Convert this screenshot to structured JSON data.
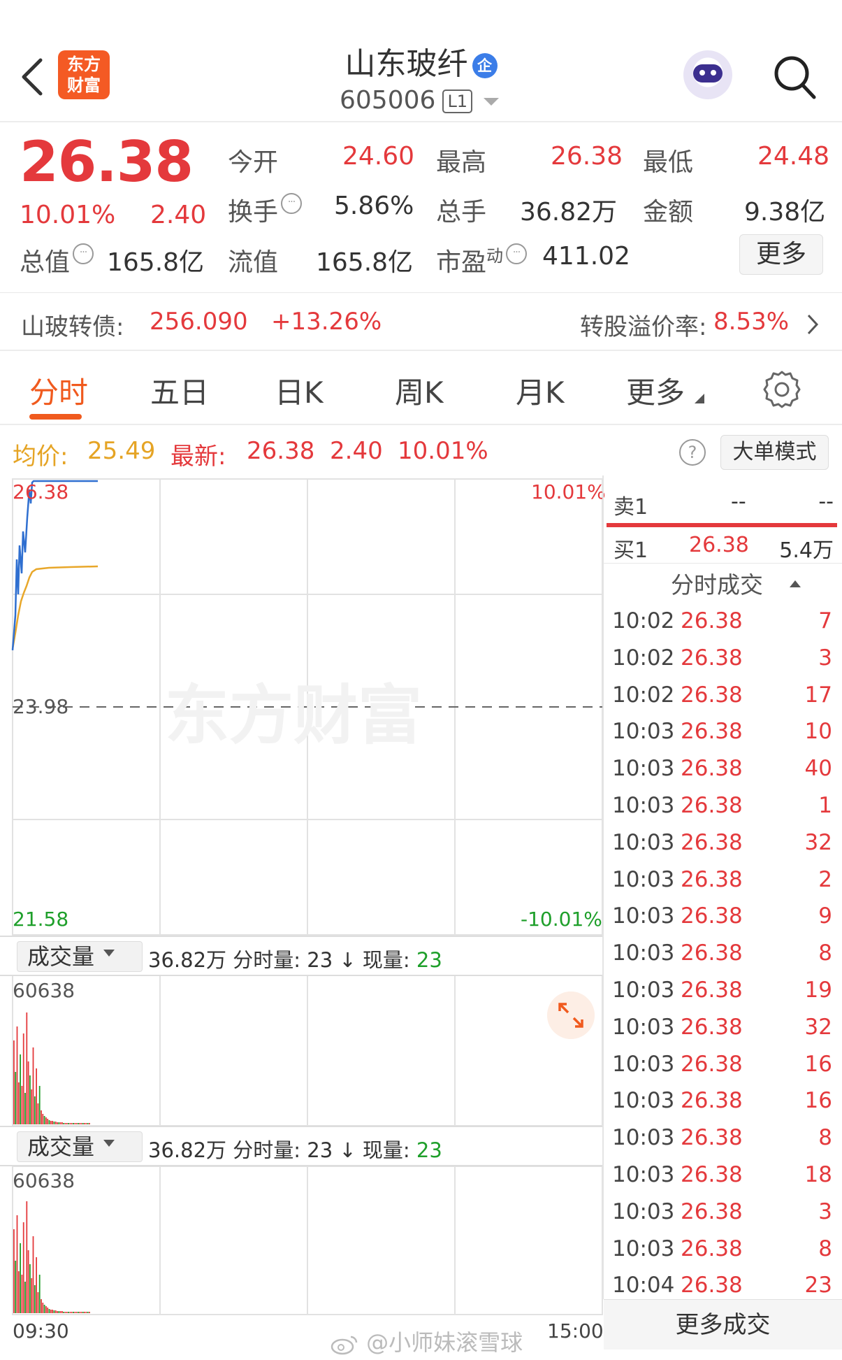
{
  "header": {
    "logo_line1": "东方",
    "logo_line2": "财富",
    "stock_name": "山东玻纤",
    "ent_badge": "企",
    "stock_code": "605006",
    "level_badge": "L1"
  },
  "quote": {
    "price": "26.38",
    "change_pct": "10.01%",
    "change": "2.40",
    "open_label": "今开",
    "open": "24.60",
    "high_label": "最高",
    "high": "26.38",
    "low_label": "最低",
    "low": "24.48",
    "turnover_label": "换手",
    "turnover": "5.86%",
    "volume_label": "总手",
    "volume": "36.82万",
    "amount_label": "金额",
    "amount": "9.38亿",
    "mktcap_label": "总值",
    "mktcap": "165.8亿",
    "float_label": "流值",
    "float_cap": "165.8亿",
    "pe_label": "市盈",
    "pe_sup": "动",
    "pe": "411.02",
    "more_label": "更多"
  },
  "bond": {
    "name": "山玻转债:",
    "price": "256.090",
    "change": "+13.26%",
    "premium_label": "转股溢价率:",
    "premium": "8.53%"
  },
  "tabs": [
    {
      "label": "分时",
      "active": true
    },
    {
      "label": "五日"
    },
    {
      "label": "日K"
    },
    {
      "label": "周K"
    },
    {
      "label": "月K"
    },
    {
      "label": "更多"
    }
  ],
  "avg_row": {
    "avg_label": "均价:",
    "avg": "25.49",
    "latest_label": "最新:",
    "latest": "26.38",
    "latest_change": "2.40",
    "latest_pct": "10.01%",
    "help": "?",
    "bigorder_label": "大单模式"
  },
  "chart": {
    "top_price": "26.38",
    "top_pct": "10.01%",
    "mid_price": "23.98",
    "bottom_price": "21.58",
    "bottom_pct": "-10.01%",
    "watermark": "东方财富",
    "x_start": "09:30",
    "x_end": "15:00",
    "colors": {
      "price_line": "#2f6fd0",
      "avg_line": "#e8a72a",
      "up": "#e4393c",
      "down": "#1e9f2a"
    }
  },
  "volume_panels": [
    {
      "select": "成交量",
      "total": "36.82万",
      "minute_label": "分时量:",
      "minute": "23",
      "arrow": "↓",
      "now_label": "现量:",
      "now": "23",
      "max": "60638"
    },
    {
      "select": "成交量",
      "total": "36.82万",
      "minute_label": "分时量:",
      "minute": "23",
      "arrow": "↓",
      "now_label": "现量:",
      "now": "23",
      "max": "60638"
    }
  ],
  "order_book": {
    "sell1_label": "卖1",
    "sell1_price": "--",
    "sell1_vol": "--",
    "buy1_label": "买1",
    "buy1_price": "26.38",
    "buy1_vol": "5.4万"
  },
  "trades_title": "分时成交",
  "trades": [
    {
      "time": "10:02",
      "price": "26.38",
      "vol": "7"
    },
    {
      "time": "10:02",
      "price": "26.38",
      "vol": "3"
    },
    {
      "time": "10:02",
      "price": "26.38",
      "vol": "17"
    },
    {
      "time": "10:03",
      "price": "26.38",
      "vol": "10"
    },
    {
      "time": "10:03",
      "price": "26.38",
      "vol": "40"
    },
    {
      "time": "10:03",
      "price": "26.38",
      "vol": "1"
    },
    {
      "time": "10:03",
      "price": "26.38",
      "vol": "32"
    },
    {
      "time": "10:03",
      "price": "26.38",
      "vol": "2"
    },
    {
      "time": "10:03",
      "price": "26.38",
      "vol": "9"
    },
    {
      "time": "10:03",
      "price": "26.38",
      "vol": "8"
    },
    {
      "time": "10:03",
      "price": "26.38",
      "vol": "19"
    },
    {
      "time": "10:03",
      "price": "26.38",
      "vol": "32"
    },
    {
      "time": "10:03",
      "price": "26.38",
      "vol": "16"
    },
    {
      "time": "10:03",
      "price": "26.38",
      "vol": "16"
    },
    {
      "time": "10:03",
      "price": "26.38",
      "vol": "8"
    },
    {
      "time": "10:03",
      "price": "26.38",
      "vol": "18"
    },
    {
      "time": "10:03",
      "price": "26.38",
      "vol": "3"
    },
    {
      "time": "10:03",
      "price": "26.38",
      "vol": "8"
    },
    {
      "time": "10:04",
      "price": "26.38",
      "vol": "23"
    }
  ],
  "more_trades_label": "更多成交",
  "footer_watermark": "@小师妹滚雪球"
}
